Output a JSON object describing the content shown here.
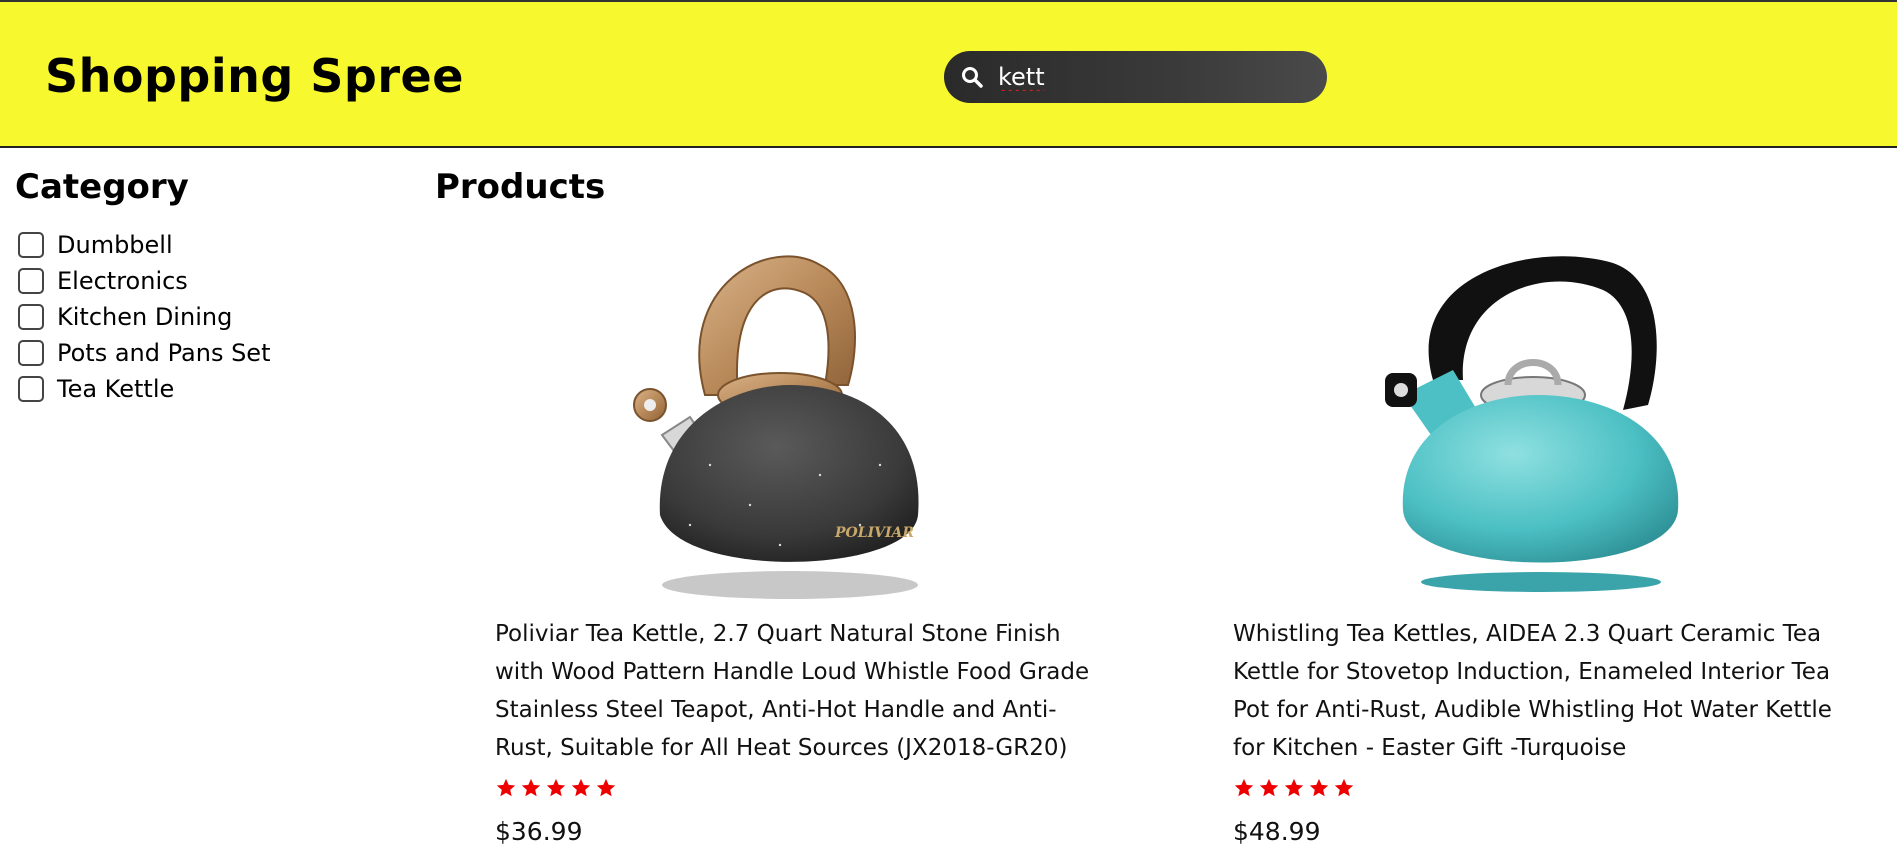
{
  "header": {
    "brand": "Shopping Spree",
    "search": {
      "value": "kett",
      "icon": "search-icon"
    },
    "colors": {
      "background": "#f8f82f",
      "search_bg": "#333333"
    }
  },
  "sidebar": {
    "title": "Category",
    "items": [
      {
        "label": "Dumbbell",
        "checked": false
      },
      {
        "label": "Electronics",
        "checked": false
      },
      {
        "label": "Kitchen Dining",
        "checked": false
      },
      {
        "label": "Pots and Pans Set",
        "checked": false
      },
      {
        "label": "Tea Kettle",
        "checked": false
      }
    ]
  },
  "products": {
    "title": "Products",
    "items": [
      {
        "title": "Poliviar Tea Kettle, 2.7 Quart Natural Stone Finish with Wood Pattern Handle Loud Whistle Food Grade Stainless Steel Teapot, Anti-Hot Handle and Anti-Rust, Suitable for All Heat Sources (JX2018-GR20)",
        "rating": 5,
        "price": "$36.99",
        "image": "black-stone-kettle-with-wood-handle",
        "image_text": "POLIVIAR"
      },
      {
        "title": "Whistling Tea Kettles, AIDEA 2.3 Quart Ceramic Tea Kettle for Stovetop Induction, Enameled Interior Tea Pot for Anti-Rust, Audible Whistling Hot Water Kettle for Kitchen - Easter Gift -Turquoise",
        "rating": 5,
        "price": "$48.99",
        "image": "turquoise-kettle-with-black-handle"
      }
    ],
    "star_color": "#ee0000"
  }
}
